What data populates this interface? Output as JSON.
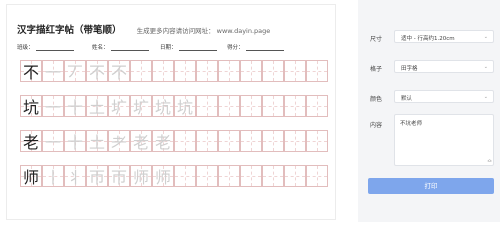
{
  "sheet": {
    "title": "汉字描红字帖（带笔顺）",
    "subtitle": "生成更多内容请访问网址： www.dayin.page",
    "meta": [
      {
        "label": "班级："
      },
      {
        "label": "姓名："
      },
      {
        "label": "日期："
      },
      {
        "label": "得分："
      }
    ],
    "rows": [
      {
        "char": "不",
        "strokes": [
          "一",
          "丆",
          "不",
          "不"
        ]
      },
      {
        "char": "坑",
        "strokes": [
          "一",
          "十",
          "土",
          "圹",
          "圹",
          "坑",
          "坑"
        ]
      },
      {
        "char": "老",
        "strokes": [
          "一",
          "十",
          "土",
          "耂",
          "老",
          "老"
        ]
      },
      {
        "char": "师",
        "strokes": [
          "丨",
          "丬",
          "帀",
          "帀",
          "师",
          "师"
        ]
      }
    ],
    "columns": 14
  },
  "panel": {
    "size_label": "尺寸",
    "size_value": "适中 - 行高约1.20cm",
    "grid_label": "格子",
    "grid_value": "田字格",
    "color_label": "颜色",
    "color_value": "默认",
    "content_label": "内容",
    "content_value": "不坑老师",
    "print_label": "打印"
  }
}
